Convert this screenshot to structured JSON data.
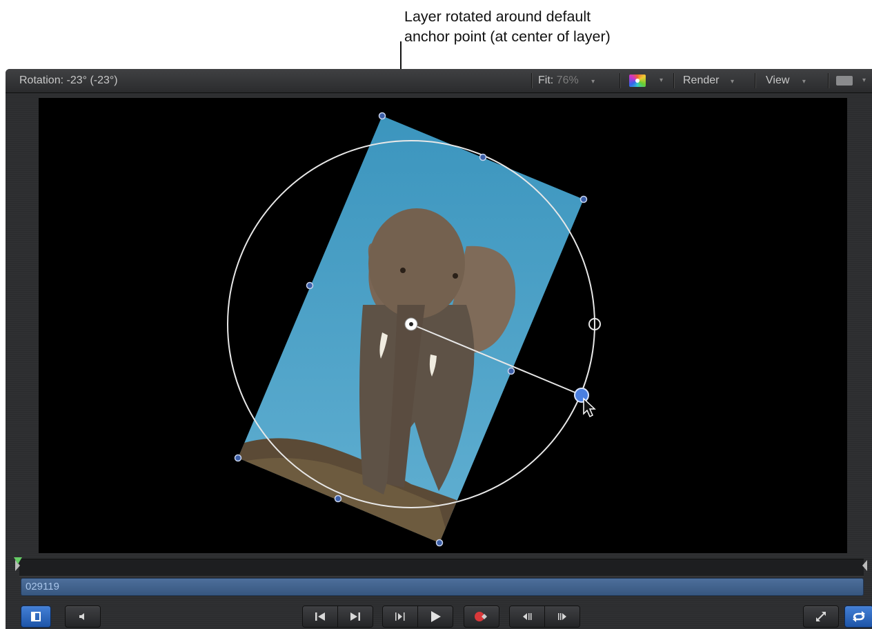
{
  "callout": {
    "text": "Layer rotated around default\nanchor point (at center of layer)"
  },
  "header": {
    "status": "Rotation: -23° (-23°)",
    "fit_label": "Fit:",
    "fit_value": "76%",
    "render_label": "Render",
    "view_label": "View",
    "caret": "▾"
  },
  "timeline": {
    "timecode": "029119"
  },
  "icons": {
    "layers": "layers-panel-icon",
    "audio": "speaker-icon",
    "start": "go-to-start-icon",
    "end": "go-to-end-icon",
    "play_selection": "play-selection-icon",
    "play": "play-icon",
    "record": "record-icon",
    "prev_frame": "previous-frame-icon",
    "next_frame": "next-frame-icon",
    "fullscreen": "fullscreen-icon",
    "loop": "loop-icon"
  },
  "colors": {
    "sky": "#4aa0c6",
    "accent_blue": "#2f6ecb",
    "timeline_bar": "#3c5e8c",
    "canvas": "#000000"
  }
}
